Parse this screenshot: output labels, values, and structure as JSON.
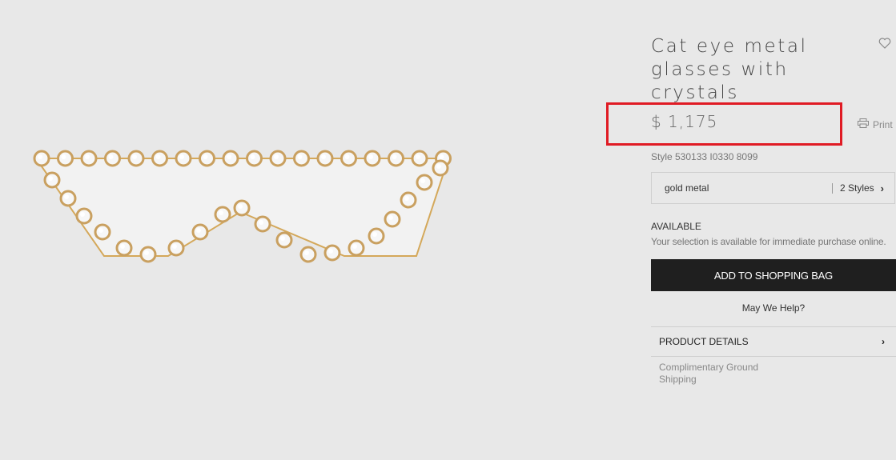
{
  "product": {
    "title": "Cat eye metal glasses with crystals",
    "price": "$ 1,175",
    "style_code": "Style 530133 I0330 8099"
  },
  "actions": {
    "print_label": "Print",
    "wishlist_icon": "heart-icon",
    "print_icon": "printer-icon"
  },
  "variant": {
    "color": "gold metal",
    "styles_count": "2 Styles"
  },
  "availability": {
    "status": "AVAILABLE",
    "message": "Your selection is available for immediate purchase online."
  },
  "buttons": {
    "add_to_bag": "ADD TO SHOPPING BAG",
    "help": "May We Help?"
  },
  "accordion": {
    "product_details": "PRODUCT DETAILS"
  },
  "shipping": {
    "text": "Complimentary Ground Shipping"
  },
  "colors": {
    "background": "#e8e8e8",
    "highlight": "#e01b24",
    "button": "#1f1f1f",
    "gold": "#d4a85a"
  }
}
